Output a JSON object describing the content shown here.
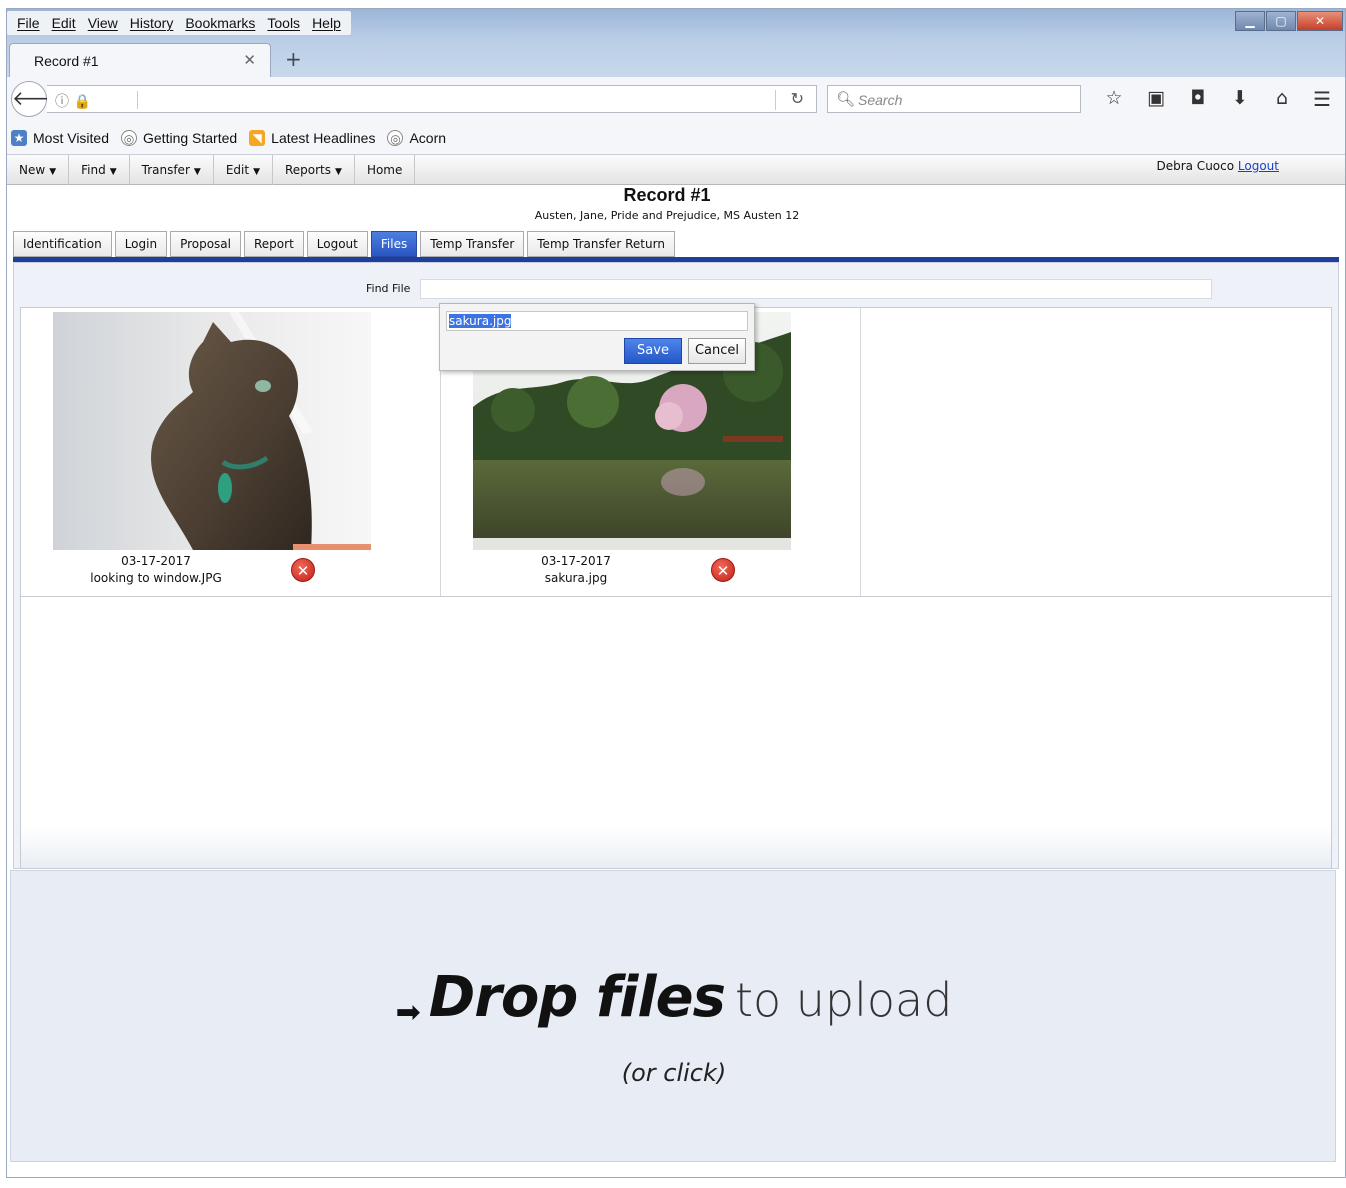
{
  "browser": {
    "menu": [
      "File",
      "Edit",
      "View",
      "History",
      "Bookmarks",
      "Tools",
      "Help"
    ],
    "tab_title": "Record #1",
    "search_placeholder": "Search",
    "bookmarks": [
      "Most Visited",
      "Getting Started",
      "Latest Headlines",
      "Acorn"
    ]
  },
  "app": {
    "menu": [
      "New",
      "Find",
      "Transfer",
      "Edit",
      "Reports",
      "Home"
    ],
    "user": "Debra Cuoco",
    "logout": "Logout",
    "record_title": "Record #1",
    "record_subtitle": "Austen, Jane, Pride and Prejudice, MS Austen 12",
    "tabs": [
      "Identification",
      "Login",
      "Proposal",
      "Report",
      "Logout",
      "Files",
      "Temp Transfer",
      "Temp Transfer Return"
    ],
    "active_tab": "Files",
    "find_file_label": "Find File"
  },
  "files": [
    {
      "date": "03-17-2017",
      "name": "looking to window.JPG"
    },
    {
      "date": "03-17-2017",
      "name": "sakura.jpg"
    }
  ],
  "rename_popup": {
    "value": "sakura.jpg",
    "save": "Save",
    "cancel": "Cancel"
  },
  "dropzone": {
    "bold": "Drop files",
    "light": "to upload",
    "sub": "(or click)"
  }
}
